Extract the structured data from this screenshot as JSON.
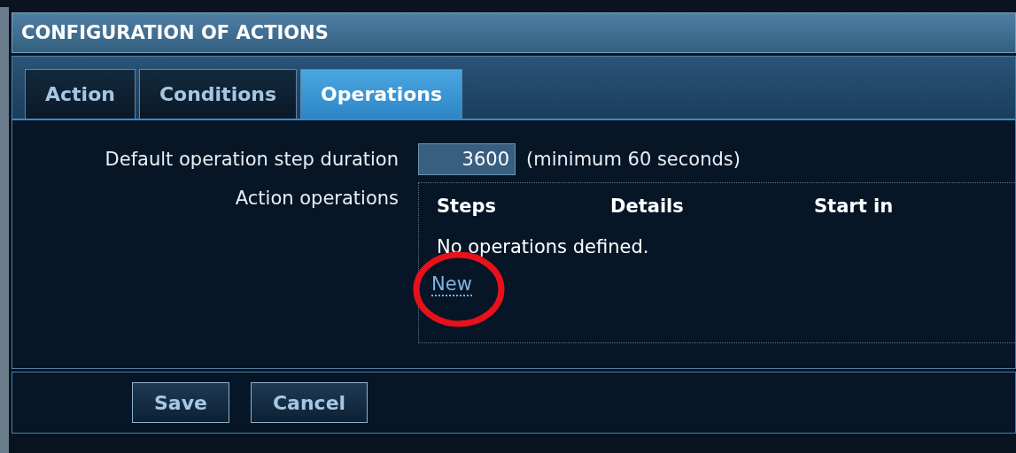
{
  "header": {
    "title": "CONFIGURATION OF ACTIONS"
  },
  "tabs": [
    {
      "label": "Action",
      "selected": false
    },
    {
      "label": "Conditions",
      "selected": false
    },
    {
      "label": "Operations",
      "selected": true
    }
  ],
  "form": {
    "duration": {
      "label": "Default operation step duration",
      "value": "3600",
      "hint": "(minimum 60 seconds)"
    },
    "operations": {
      "label": "Action operations",
      "columns": [
        "Steps",
        "Details",
        "Start in"
      ],
      "empty_text": "No operations defined.",
      "new_link": "New"
    }
  },
  "buttons": [
    {
      "label": "Save"
    },
    {
      "label": "Cancel"
    }
  ]
}
